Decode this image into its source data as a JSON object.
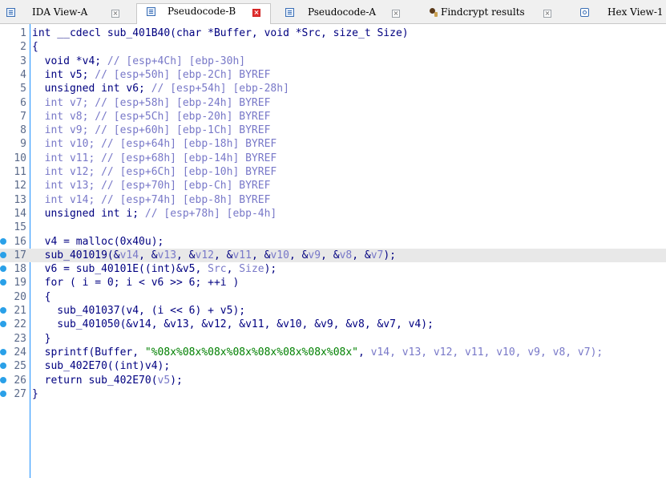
{
  "tabs": [
    {
      "label": "IDA View-A",
      "icon": "doc-icon",
      "active": false
    },
    {
      "label": "Pseudocode-B",
      "icon": "doc-icon",
      "active": true
    },
    {
      "label": "Pseudocode-A",
      "icon": "doc-icon",
      "active": false
    },
    {
      "label": "Findcrypt results",
      "icon": "findcrypt-icon",
      "active": false
    },
    {
      "label": "Hex View-1",
      "icon": "hex-icon",
      "active": false
    }
  ],
  "colors": {
    "breakpoint_dot": "#2aa0e8",
    "current_line": "#e8e8e8",
    "code": "#000080",
    "comment": "#7878c8",
    "string": "#008000"
  },
  "current_line": 17,
  "code_lines": [
    {
      "num": "1",
      "dot": false,
      "segs": [
        [
          "kw",
          "int __cdecl sub_401B40(char *Buffer, void *Src, size_t Size)"
        ]
      ]
    },
    {
      "num": "2",
      "dot": false,
      "segs": [
        [
          "kw",
          "{"
        ]
      ]
    },
    {
      "num": "3",
      "dot": false,
      "segs": [
        [
          "kw",
          "  void *v4; "
        ],
        [
          "dim",
          "// [esp+4Ch] [ebp-30h]"
        ]
      ]
    },
    {
      "num": "4",
      "dot": false,
      "segs": [
        [
          "kw",
          "  int v5; "
        ],
        [
          "dim",
          "// [esp+50h] [ebp-2Ch] BYREF"
        ]
      ]
    },
    {
      "num": "5",
      "dot": false,
      "segs": [
        [
          "kw",
          "  unsigned int v6; "
        ],
        [
          "dim",
          "// [esp+54h] [ebp-28h]"
        ]
      ]
    },
    {
      "num": "6",
      "dot": false,
      "segs": [
        [
          "dim",
          "  int v7; // [esp+58h] [ebp-24h] BYREF"
        ]
      ]
    },
    {
      "num": "7",
      "dot": false,
      "segs": [
        [
          "dim",
          "  int v8; // [esp+5Ch] [ebp-20h] BYREF"
        ]
      ]
    },
    {
      "num": "8",
      "dot": false,
      "segs": [
        [
          "dim",
          "  int v9; // [esp+60h] [ebp-1Ch] BYREF"
        ]
      ]
    },
    {
      "num": "9",
      "dot": false,
      "segs": [
        [
          "dim",
          "  int v10; // [esp+64h] [ebp-18h] BYREF"
        ]
      ]
    },
    {
      "num": "10",
      "dot": false,
      "segs": [
        [
          "dim",
          "  int v11; // [esp+68h] [ebp-14h] BYREF"
        ]
      ]
    },
    {
      "num": "11",
      "dot": false,
      "segs": [
        [
          "dim",
          "  int v12; // [esp+6Ch] [ebp-10h] BYREF"
        ]
      ]
    },
    {
      "num": "12",
      "dot": false,
      "segs": [
        [
          "dim",
          "  int v13; // [esp+70h] [ebp-Ch] BYREF"
        ]
      ]
    },
    {
      "num": "13",
      "dot": false,
      "segs": [
        [
          "dim",
          "  int v14; // [esp+74h] [ebp-8h] BYREF"
        ]
      ]
    },
    {
      "num": "14",
      "dot": false,
      "segs": [
        [
          "kw",
          "  unsigned int i; "
        ],
        [
          "dim",
          "// [esp+78h] [ebp-4h]"
        ]
      ]
    },
    {
      "num": "15",
      "dot": false,
      "segs": [
        [
          "kw",
          ""
        ]
      ]
    },
    {
      "num": "16",
      "dot": true,
      "segs": [
        [
          "kw",
          "  v4 = malloc(0x40u);"
        ]
      ]
    },
    {
      "num": "17",
      "dot": true,
      "segs": [
        [
          "kw",
          "  sub_401019(&"
        ],
        [
          "dim",
          "v14"
        ],
        [
          "kw",
          ", &"
        ],
        [
          "dim",
          "v13"
        ],
        [
          "kw",
          ", &"
        ],
        [
          "dim",
          "v12"
        ],
        [
          "kw",
          ", &"
        ],
        [
          "dim",
          "v11"
        ],
        [
          "kw",
          ", &"
        ],
        [
          "dim",
          "v10"
        ],
        [
          "kw",
          ", &"
        ],
        [
          "dim",
          "v9"
        ],
        [
          "kw",
          ", &"
        ],
        [
          "dim",
          "v8"
        ],
        [
          "kw",
          ", &"
        ],
        [
          "dim",
          "v7"
        ],
        [
          "kw",
          ");"
        ]
      ]
    },
    {
      "num": "18",
      "dot": true,
      "segs": [
        [
          "kw",
          "  v6 = sub_40101E((int)&v5, "
        ],
        [
          "dim",
          "Src"
        ],
        [
          "kw",
          ", "
        ],
        [
          "dim",
          "Size"
        ],
        [
          "kw",
          ");"
        ]
      ]
    },
    {
      "num": "19",
      "dot": true,
      "segs": [
        [
          "kw",
          "  for ( i = 0; i < v6 >> 6; ++i )"
        ]
      ]
    },
    {
      "num": "20",
      "dot": false,
      "segs": [
        [
          "kw",
          "  {"
        ]
      ]
    },
    {
      "num": "21",
      "dot": true,
      "segs": [
        [
          "kw",
          "    sub_401037(v4, (i << 6) + v5);"
        ]
      ]
    },
    {
      "num": "22",
      "dot": true,
      "segs": [
        [
          "kw",
          "    sub_401050(&v14, &v13, &v12, &v11, &v10, &v9, &v8, &v7, v4);"
        ]
      ]
    },
    {
      "num": "23",
      "dot": false,
      "segs": [
        [
          "kw",
          "  }"
        ]
      ]
    },
    {
      "num": "24",
      "dot": true,
      "segs": [
        [
          "kw",
          "  sprintf(Buffer, "
        ],
        [
          "str",
          "\"%08x%08x%08x%08x%08x%08x%08x%08x\""
        ],
        [
          "kw",
          ", "
        ],
        [
          "dim",
          "v14, v13, v12, v11, v10, v9, v8, v7);"
        ]
      ]
    },
    {
      "num": "25",
      "dot": true,
      "segs": [
        [
          "kw",
          "  sub_402E70((int)v4);"
        ]
      ]
    },
    {
      "num": "26",
      "dot": true,
      "segs": [
        [
          "kw",
          "  return sub_402E70("
        ],
        [
          "dim",
          "v5"
        ],
        [
          "kw",
          ");"
        ]
      ]
    },
    {
      "num": "27",
      "dot": true,
      "segs": [
        [
          "kw",
          "}"
        ]
      ]
    }
  ]
}
